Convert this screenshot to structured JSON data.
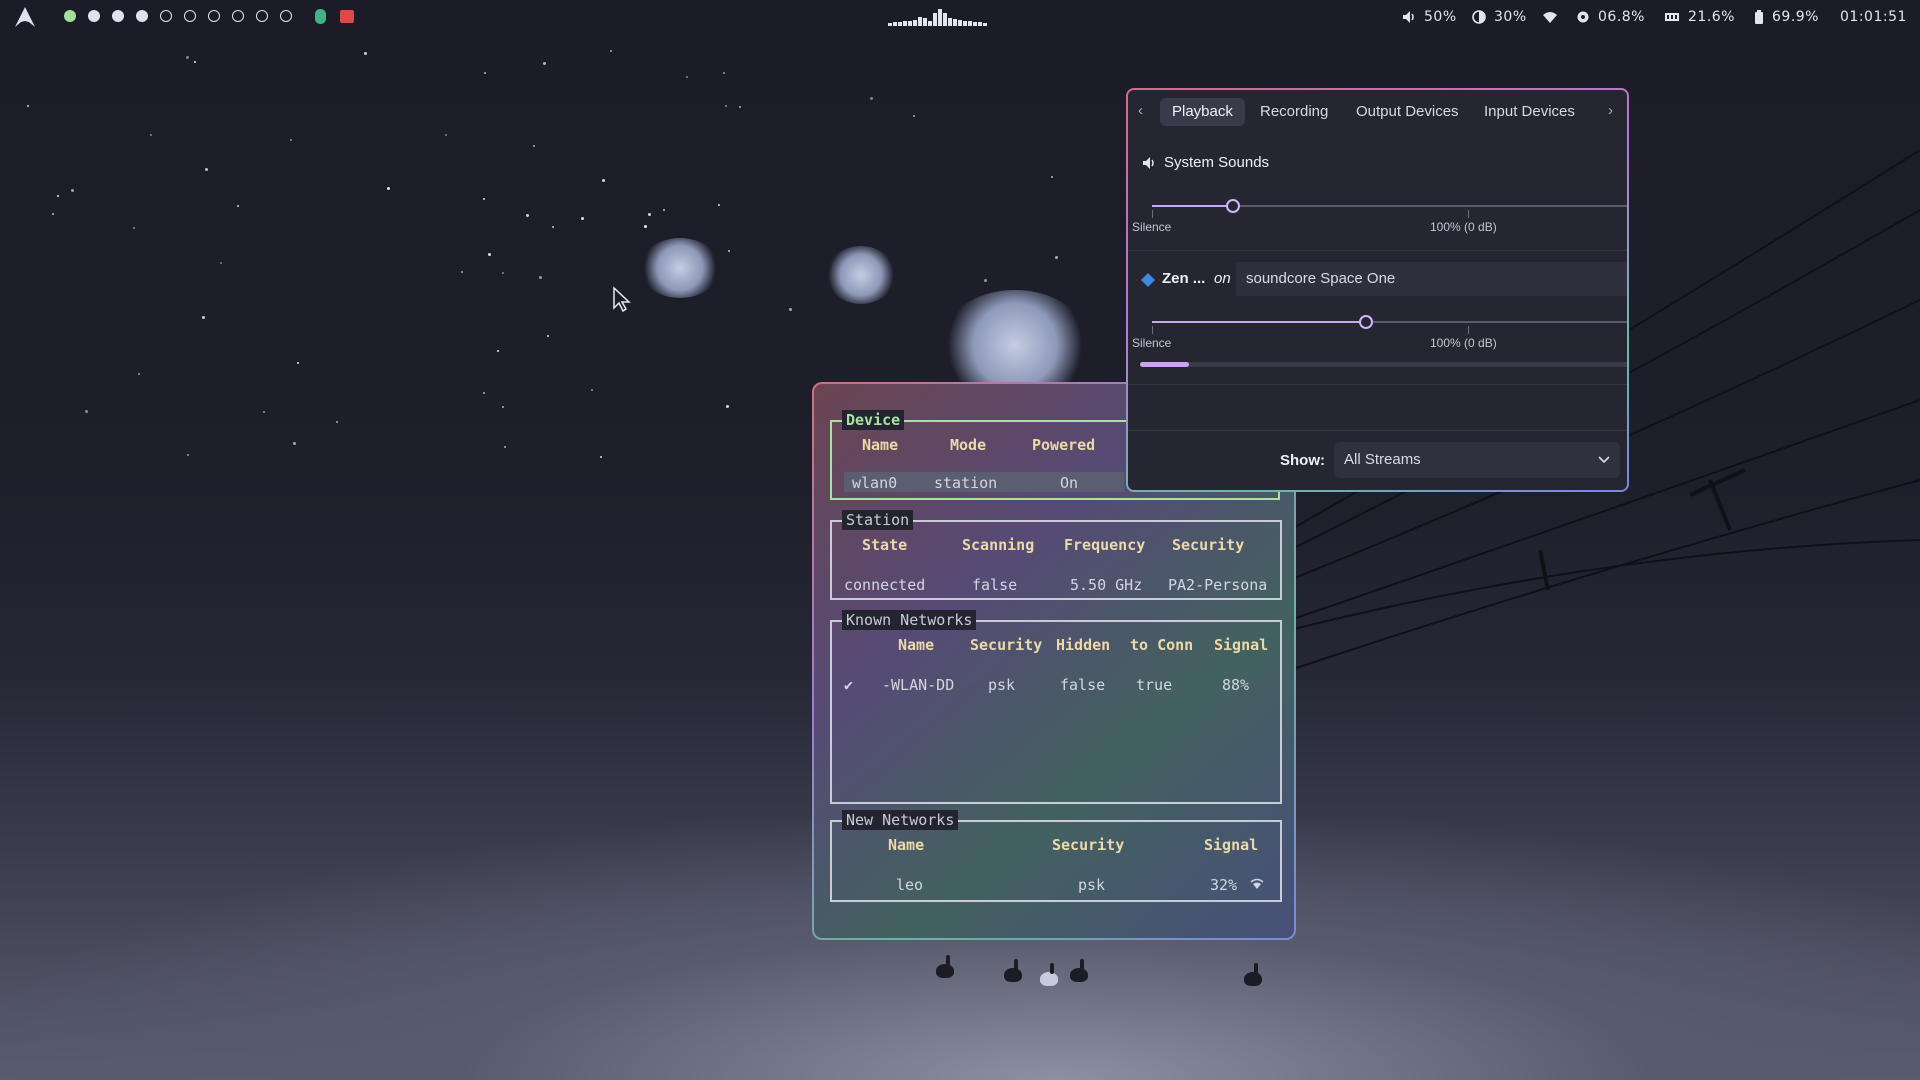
{
  "topbar": {
    "logo": "arch-linux-logo-icon",
    "workspaces": [
      "active",
      "filled",
      "filled",
      "filled",
      "empty",
      "empty",
      "empty",
      "empty",
      "empty",
      "empty"
    ],
    "tray_icons": [
      "spotify-green-icon",
      "red-app-icon"
    ],
    "visualizer_levels": [
      0.15,
      0.2,
      0.2,
      0.25,
      0.3,
      0.35,
      0.5,
      0.45,
      0.3,
      0.7,
      0.95,
      0.7,
      0.45,
      0.4,
      0.35,
      0.3,
      0.25,
      0.2,
      0.2,
      0.15
    ],
    "volume": "50%",
    "brightness": "30%",
    "cpu": "06.8%",
    "memory": "21.6%",
    "battery": "69.9%",
    "clock": "01:01:51",
    "colors": {
      "text": "#e3e5ee",
      "active_workspace": "#9fe09a"
    }
  },
  "terminal": {
    "device": {
      "label": "Device",
      "headers": [
        "Name",
        "Mode",
        "Powered"
      ],
      "row": [
        "wlan0",
        "station",
        "On"
      ]
    },
    "station": {
      "label": "Station",
      "headers": [
        "State",
        "Scanning",
        "Frequency",
        "Security"
      ],
      "row": [
        "connected",
        "false",
        "5.50 GHz",
        "PA2-Persona"
      ]
    },
    "known_networks": {
      "label": "Known Networks",
      "headers": [
        "Name",
        "Security",
        "Hidden",
        "to Conn",
        "Signal"
      ],
      "rows": [
        {
          "check": "✔",
          "name": "-WLAN-DD",
          "security": "psk",
          "hidden": "false",
          "autoconnect": "true",
          "signal": "88%"
        }
      ]
    },
    "new_networks": {
      "label": "New Networks",
      "headers": [
        "Name",
        "Security",
        "Signal"
      ],
      "rows": [
        {
          "name": "leo",
          "security": "psk",
          "signal": "32%"
        }
      ]
    },
    "colors": {
      "accent_green": "#a6e3a1",
      "header_yellow": "#ecd9a8"
    }
  },
  "pavucontrol": {
    "tabs": [
      "Playback",
      "Recording",
      "Output Devices",
      "Input Devices"
    ],
    "active_tab": "Playback",
    "streams": [
      {
        "name": "System Sounds",
        "icon": "speaker-icon",
        "volume_fraction": 0.17,
        "label_min": "Silence",
        "label_max": "100% (0 dB)"
      },
      {
        "name": "Zen ...",
        "on_text": "on",
        "device": "soundcore Space One",
        "icon": "zen-browser-icon",
        "volume_fraction": 0.45,
        "meter_fraction": 0.1,
        "label_min": "Silence",
        "label_max": "100% (0 dB)"
      }
    ],
    "show_label": "Show:",
    "show_value": "All Streams",
    "colors": {
      "accent": "#c8a9f0"
    }
  }
}
